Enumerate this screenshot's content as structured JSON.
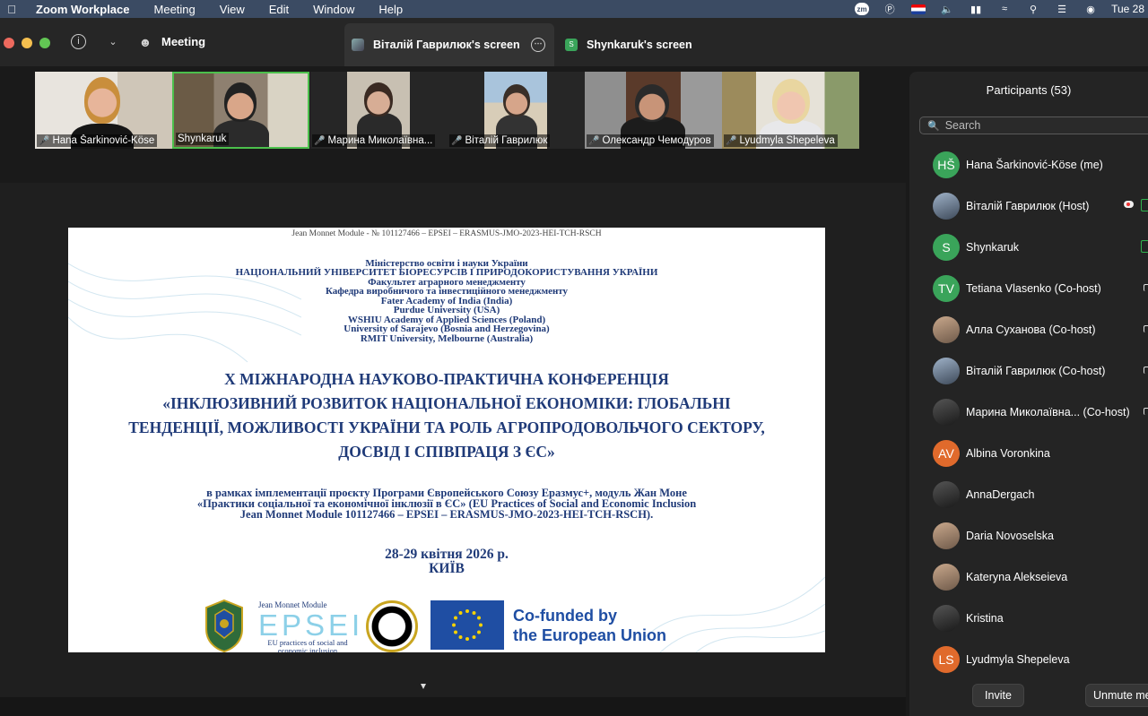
{
  "menubar": {
    "app_name": "Zoom Workplace",
    "items": [
      "Meeting",
      "View",
      "Edit",
      "Window",
      "Help"
    ],
    "clock": "Tue 28"
  },
  "titlebar": {
    "meeting_label": "Meeting",
    "tab_active": "Віталій Гаврилюк's screen",
    "tab_other": "Shynkaruk's screen",
    "tab_other_avatar": "S"
  },
  "thumbnails": [
    {
      "name": "Hana Šarkinović-Köse",
      "muted": true
    },
    {
      "name": "Shynkaruk",
      "muted": false
    },
    {
      "name": "Марина Миколаївна...",
      "muted": true
    },
    {
      "name": "Віталій Гаврилюк",
      "muted": true
    },
    {
      "name": "Олександр Чемодуров",
      "muted": true
    },
    {
      "name": "Lyudmyla Shepeleva",
      "muted": true
    }
  ],
  "slide": {
    "header": "Jean Monnet Module - № 101127466 – EPSEI – ERASMUS-JMO-2023-HEI-TCH-RSCH",
    "institutions": [
      "Міністерство освіти і науки України",
      "НАЦІОНАЛЬНИЙ УНІВЕРСИТЕТ БІОРЕСУРСІВ І ПРИРОДОКОРИСТУВАННЯ УКРАЇНИ",
      "Факультет аграрного менеджменту",
      "Кафедра виробничого та інвестиційного менеджменту",
      "Fater Academy of India (India)",
      "Purdue University (USA)",
      "WSHIU Academy of Applied Sciences (Poland)",
      "University of Sarajevo (Bosnia and Herzegovina)",
      "RMIT University, Melbourne (Australia)"
    ],
    "conference": [
      "Х МІЖНАРОДНА НАУКОВО-ПРАКТИЧНА КОНФЕРЕНЦІЯ",
      "«ІНКЛЮЗИВНИЙ РОЗВИТОК НАЦІОНАЛЬНОЇ ЕКОНОМІКИ: ГЛОБАЛЬНІ",
      "ТЕНДЕНЦІЇ, МОЖЛИВОСТІ УКРАЇНИ ТА РОЛЬ АГРОПРОДОВОЛЬЧОГО СЕКТОРУ,",
      "ДОСВІД І СПІВПРАЦЯ З ЄС»"
    ],
    "project": [
      "в рамках імплементації проєкту Програми Європейського Союзу Еразмус+, модуль Жан Моне",
      "«Практики соціальної та економічної інклюзії в ЄС» (EU Practices of Social and Economic Inclusion",
      "Jean Monnet Module 101127466 – EPSEI – ERASMUS-JMO-2023-HEI-TCH-RSCH)."
    ],
    "date": "28-29 квітня 2026 р.",
    "city": "КИЇВ",
    "jm_title": "Jean Monnet Module",
    "epsei": "EPSEI",
    "epsei_sub": "EU practices of social and economic inclusion",
    "eu_line1": "Co-funded by",
    "eu_line2": "the European Union"
  },
  "participants": {
    "title": "Participants (53)",
    "search_placeholder": "Search",
    "list": [
      {
        "name": "Hana Šarkinović-Köse (me)",
        "initials": "HŠ",
        "color": "#3aa45a",
        "icon": "none"
      },
      {
        "name": "Віталій Гаврилюк (Host)",
        "initials": "",
        "color": "",
        "icon": "video-green"
      },
      {
        "name": "Shynkaruk",
        "initials": "S",
        "color": "#3aa45a",
        "icon": "video-green"
      },
      {
        "name": "Tetiana Vlasenko (Co-host)",
        "initials": "TV",
        "color": "#3aa45a",
        "icon": "mic"
      },
      {
        "name": "Алла Суханова (Co-host)",
        "initials": "",
        "color": "",
        "icon": "mic"
      },
      {
        "name": "Віталій Гаврилюк (Co-host)",
        "initials": "",
        "color": "",
        "icon": "mic"
      },
      {
        "name": "Марина Миколаївна...  (Co-host)",
        "initials": "",
        "color": "",
        "icon": "mic"
      },
      {
        "name": "Albina Voronkina",
        "initials": "AV",
        "color": "#e06a2c",
        "icon": "none"
      },
      {
        "name": "AnnaDergach",
        "initials": "",
        "color": "",
        "icon": "none"
      },
      {
        "name": "Daria Novoselska",
        "initials": "",
        "color": "",
        "icon": "none"
      },
      {
        "name": "Kateryna Alekseieva",
        "initials": "",
        "color": "",
        "icon": "none"
      },
      {
        "name": "Kristina",
        "initials": "",
        "color": "",
        "icon": "none"
      },
      {
        "name": "Lyudmyla Shepeleva",
        "initials": "LS",
        "color": "#e06a2c",
        "icon": "none"
      }
    ],
    "invite_label": "Invite",
    "unmute_label": "Unmute me"
  }
}
